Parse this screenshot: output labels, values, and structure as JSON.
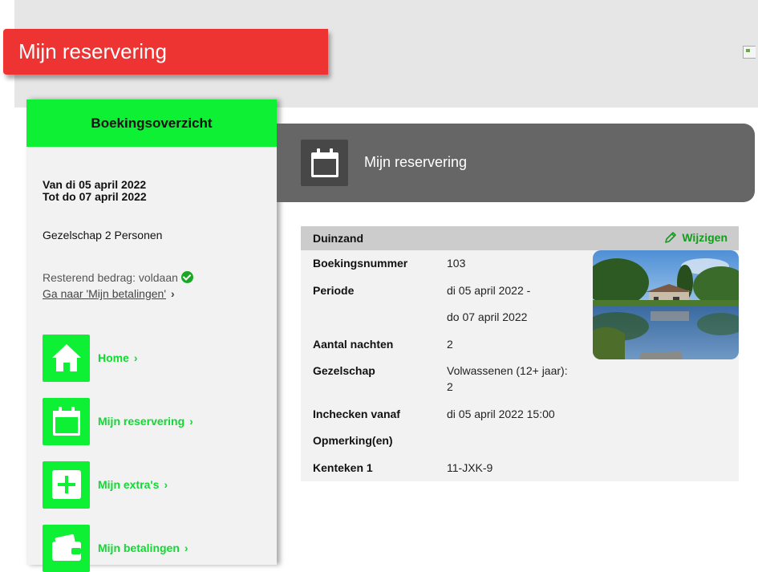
{
  "page": {
    "title": "Mijn reservering"
  },
  "sidebar": {
    "header": "Boekingsoverzicht",
    "date_from": "Van di 05 april 2022",
    "date_to": "Tot do 07 april 2022",
    "party": "Gezelschap 2 Personen",
    "remaining": "Resterend bedrag: voldaan",
    "payments_link": "Ga naar 'Mijn betalingen'",
    "nav": [
      {
        "label": "Home",
        "icon": "home-icon"
      },
      {
        "label": "Mijn reservering",
        "icon": "calendar-icon"
      },
      {
        "label": "Mijn extra's",
        "icon": "plus-icon"
      },
      {
        "label": "Mijn betalingen",
        "icon": "wallet-icon"
      }
    ]
  },
  "reservation": {
    "header_title": "Mijn reservering",
    "accommodation": "Duinzand",
    "edit_label": "Wijzigen",
    "rows": [
      {
        "label": "Boekingsnummer",
        "value": "103"
      },
      {
        "label": "Periode",
        "value": "di 05 april 2022 -"
      },
      {
        "label": "",
        "value": "do 07 april 2022"
      },
      {
        "label": "Aantal nachten",
        "value": "2"
      },
      {
        "label": "Gezelschap",
        "value": "Volwassenen (12+ jaar): 2"
      },
      {
        "label": "Inchecken vanaf",
        "value": "di 05 april 2022 15:00"
      },
      {
        "label": "Opmerking(en)",
        "value": ""
      },
      {
        "label": "Kenteken 1",
        "value": "11-JXK-9"
      }
    ]
  },
  "colors": {
    "brand_red": "#ee3333",
    "brand_green": "#0df033",
    "link_green": "#11d932",
    "header_gray": "#666666"
  }
}
